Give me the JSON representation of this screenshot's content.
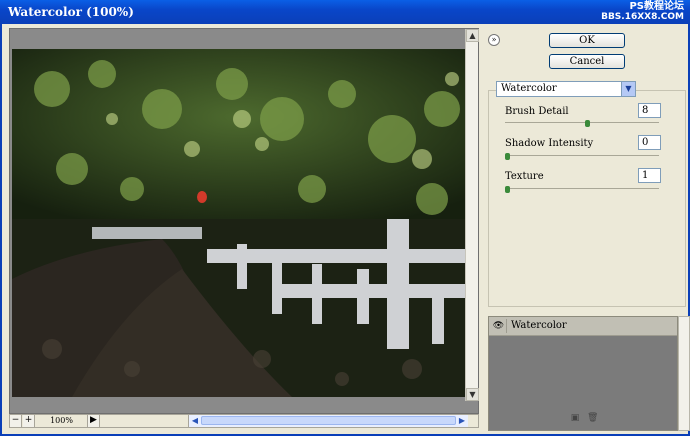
{
  "window": {
    "title": "Watercolor (100%)"
  },
  "watermark": {
    "line1": "PS教程论坛",
    "line2": "BBS.16XX8.COM"
  },
  "buttons": {
    "ok": "OK",
    "cancel": "Cancel"
  },
  "filter": {
    "selected": "Watercolor"
  },
  "params": [
    {
      "label": "Brush Detail",
      "value": "8",
      "level": 0.53
    },
    {
      "label": "Shadow Intensity",
      "value": "0",
      "level": 0.0
    },
    {
      "label": "Texture",
      "value": "1",
      "level": 0.0
    }
  ],
  "status": {
    "zoom": "100%"
  },
  "layers": [
    {
      "name": "Watercolor"
    }
  ],
  "icons": {
    "collapse": "chevron-double-down-icon",
    "eye": "eye-icon",
    "new_layer": "new-layer-icon",
    "delete": "trash-icon"
  }
}
